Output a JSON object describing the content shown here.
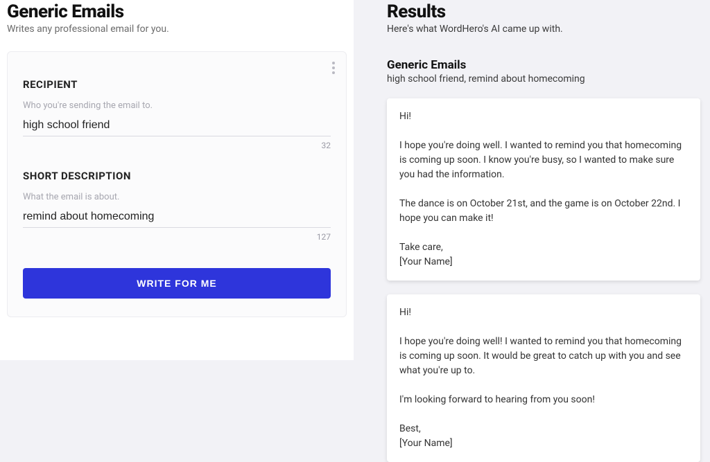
{
  "left": {
    "title": "Generic Emails",
    "subtitle": "Writes any professional email for you.",
    "fields": {
      "recipient": {
        "label": "RECIPIENT",
        "hint": "Who you're sending the email to.",
        "value": "high school friend",
        "counter": "32"
      },
      "description": {
        "label": "SHORT DESCRIPTION",
        "hint": "What the email is about.",
        "value": "remind about homecoming",
        "counter": "127"
      }
    },
    "cta": "WRITE FOR ME"
  },
  "right": {
    "title": "Results",
    "subtitle": "Here's what WordHero's AI came up with.",
    "tool_name": "Generic Emails",
    "tool_inputs": "high school friend, remind about homecoming",
    "results": [
      "Hi!\n\nI hope you're doing well. I wanted to remind you that homecoming is coming up soon. I know you're busy, so I wanted to make sure you had the information.\n\nThe dance is on October 21st, and the game is on October 22nd. I hope you can make it!\n\nTake care,\n[Your Name]",
      "Hi!\n\nI hope you're doing well! I wanted to remind you that homecoming is coming up soon. It would be great to catch up with you and see what you're up to.\n\nI'm looking forward to hearing from you soon!\n\nBest,\n[Your Name]"
    ]
  }
}
